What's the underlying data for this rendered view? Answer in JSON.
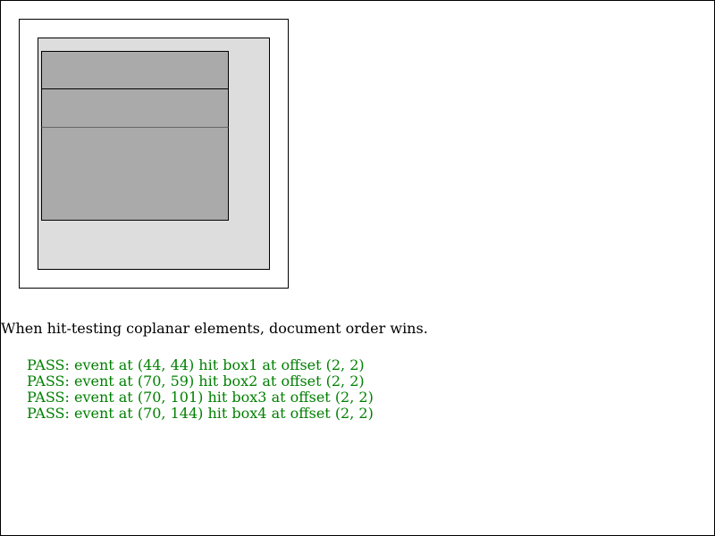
{
  "colors": {
    "background": "#ffffff",
    "border": "#000000",
    "box1_fill": "#dddddd",
    "inner_box_fill": "#aaaaaa",
    "pass": "#008000"
  },
  "description": "When hit-testing coplanar elements, document order wins.",
  "results": [
    {
      "text": "PASS: event at (44, 44) hit box1 at offset (2, 2)"
    },
    {
      "text": "PASS: event at (70, 59) hit box2 at offset (2, 2)"
    },
    {
      "text": "PASS: event at (70, 101) hit box3 at offset (2, 2)"
    },
    {
      "text": "PASS: event at (70, 144) hit box4 at offset (2, 2)"
    }
  ]
}
